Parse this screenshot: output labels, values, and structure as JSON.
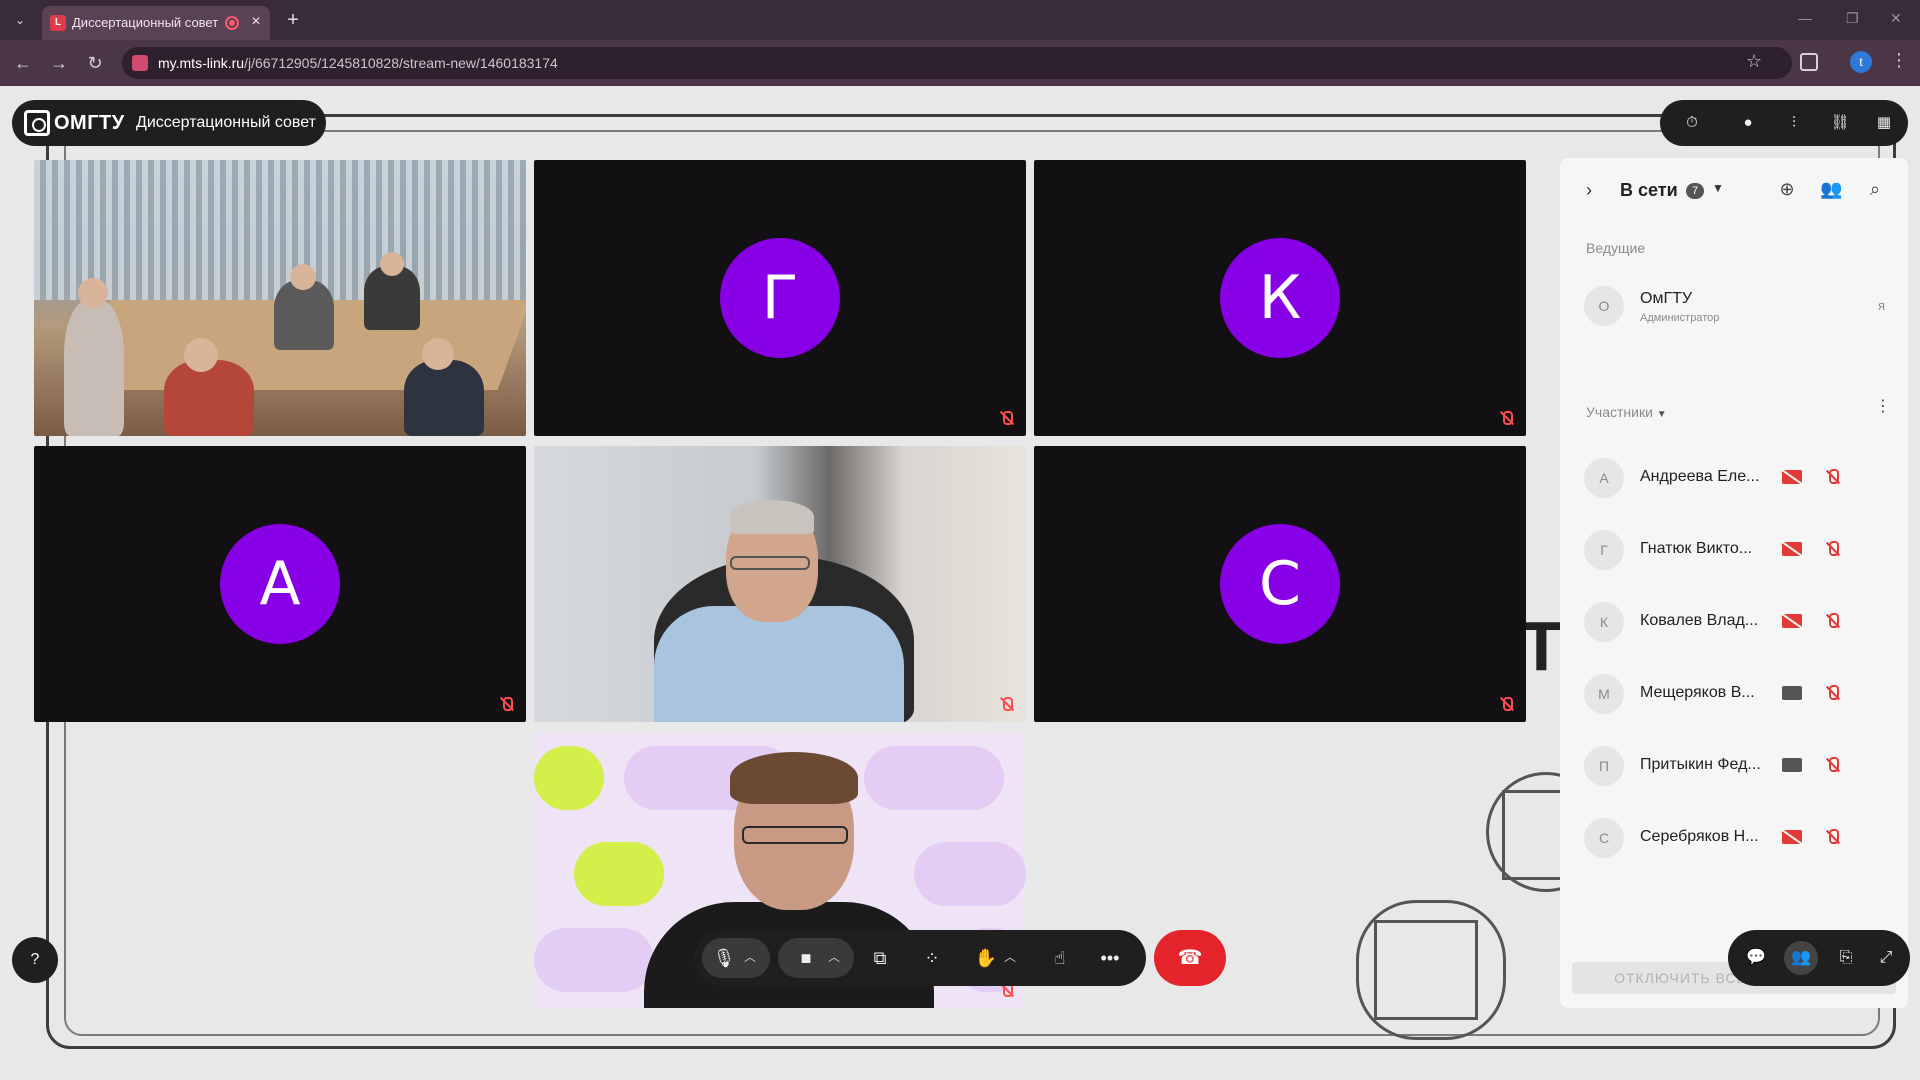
{
  "browser": {
    "tab_title": "Диссертационный совет -",
    "tab_favicon": "L",
    "new_tab": "+",
    "url_host": "my.mts-link.ru",
    "url_path": "/j/66712905/1245810828/stream-new/1460183174",
    "profile_initial": "t",
    "icons": [
      "back-icon",
      "forward-icon",
      "reload-icon",
      "star-icon",
      "extensions-icon",
      "menu-icon"
    ]
  },
  "meeting": {
    "logo": "ОМГТУ",
    "title": "Диссертационный совет",
    "top_tools": [
      "timer-icon",
      "record-icon",
      "audio-levels-icon",
      "link-icon",
      "apps-grid-icon"
    ]
  },
  "tiles": [
    {
      "type": "video",
      "scene": "conference-room"
    },
    {
      "type": "avatar",
      "letter": "Г",
      "mic_muted": true
    },
    {
      "type": "avatar",
      "letter": "К",
      "mic_muted": true
    },
    {
      "type": "avatar",
      "letter": "А",
      "mic_muted": true
    },
    {
      "type": "video",
      "scene": "man-blue-shirt",
      "mic_muted": true
    },
    {
      "type": "avatar",
      "letter": "С",
      "mic_muted": true
    },
    {
      "type": "video",
      "scene": "man-purple-background",
      "mic_muted": true
    }
  ],
  "background": {
    "partial_text": "ТЕ"
  },
  "panel": {
    "title": "В сети",
    "count": "7",
    "hosts_label": "Ведущие",
    "host": {
      "initial": "О",
      "name": "ОмГТУ",
      "role": "Администратор",
      "me": "я"
    },
    "participants_label": "Участники",
    "participants": [
      {
        "initial": "А",
        "name": "Андреева Еле...",
        "camera": "off",
        "mic": "off"
      },
      {
        "initial": "Г",
        "name": "Гнатюк Викто...",
        "camera": "off",
        "mic": "off"
      },
      {
        "initial": "К",
        "name": "Ковалев Влад...",
        "camera": "off",
        "mic": "off"
      },
      {
        "initial": "М",
        "name": "Мещеряков В...",
        "camera": "on",
        "mic": "off"
      },
      {
        "initial": "П",
        "name": "Притыкин Фед...",
        "camera": "on",
        "mic": "off"
      },
      {
        "initial": "С",
        "name": "Серебряков Н...",
        "camera": "off",
        "mic": "off"
      }
    ],
    "mute_all": "ОТКЛЮЧИТЬ ВСЕМ МИКРОФОН"
  },
  "controls": {
    "help": "?",
    "buttons": [
      "microphone-icon",
      "camera-icon",
      "screen-share-icon",
      "apps-icon",
      "raise-hand-icon",
      "reaction-icon",
      "more-icon"
    ],
    "hangup": "hangup-icon",
    "right": [
      "chat-icon",
      "participants-icon",
      "files-icon",
      "layout-icon"
    ]
  },
  "colors": {
    "avatar_purple": "#8800e6",
    "muted_red": "#e53935",
    "hangup_red": "#e5232b",
    "chrome_tab": "#5a4256"
  }
}
